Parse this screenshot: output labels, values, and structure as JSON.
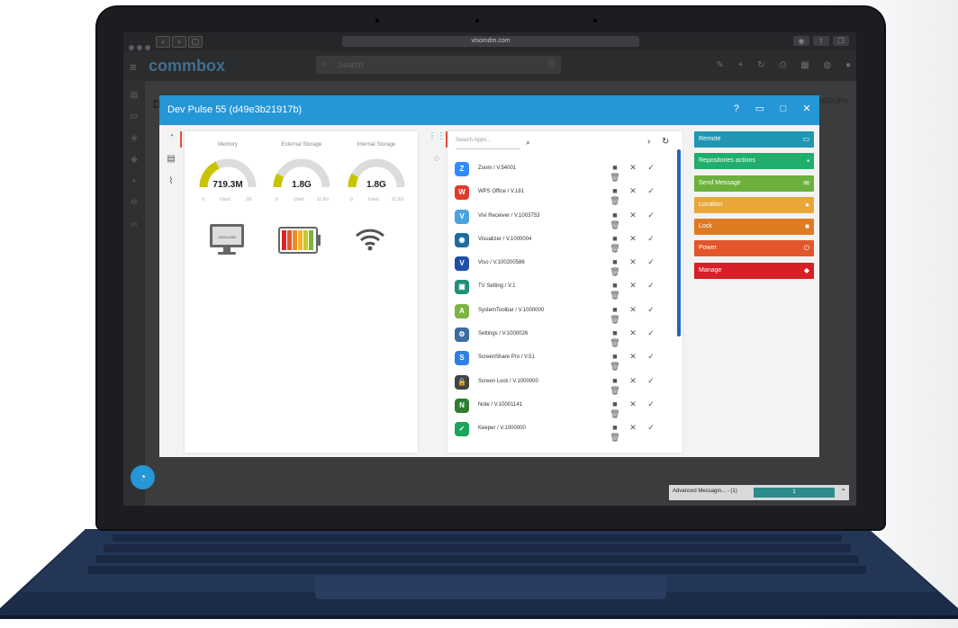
{
  "browser": {
    "url": "visomdm.com"
  },
  "app": {
    "logo": "commbox",
    "search_placeholder": "Search",
    "page_initial": "D",
    "groups_label": "GROUPS"
  },
  "modal": {
    "title": "Dev Pulse 55 (d49e3b21917b)",
    "gauges": [
      {
        "label": "Memory",
        "value": "719.3M",
        "min": "0",
        "max": "2G",
        "used": "Used",
        "fraction": 0.36
      },
      {
        "label": "External Storage",
        "value": "1.8G",
        "min": "0",
        "max": "11.6G",
        "used": "Used",
        "fraction": 0.16
      },
      {
        "label": "Internal Storage",
        "value": "1.8G",
        "min": "0",
        "max": "11.6G",
        "used": "Used",
        "fraction": 0.16
      }
    ],
    "display_resolution": "1920x1080",
    "search_apps_placeholder": "Search Apps...",
    "apps": [
      {
        "name": "Zoom / V.54001",
        "color": "#2d8cff",
        "glyph": "Z"
      },
      {
        "name": "WPS Office / V.181",
        "color": "#e03b2a",
        "glyph": "W"
      },
      {
        "name": "Vivi Receiver / V.1003753",
        "color": "#4aa3df",
        "glyph": "V"
      },
      {
        "name": "Visualizer / V.1000004",
        "color": "#1e6b9c",
        "glyph": "◉"
      },
      {
        "name": "Viso / V.100200586",
        "color": "#1f4fa8",
        "glyph": "V"
      },
      {
        "name": "TV Setting / V.1",
        "color": "#1e8f7a",
        "glyph": "▣"
      },
      {
        "name": "SystemToolbar / V.1000000",
        "color": "#7cb342",
        "glyph": "A"
      },
      {
        "name": "Settings / V.1000026",
        "color": "#3b6e9e",
        "glyph": "⚙"
      },
      {
        "name": "ScreenShare Pro / V.51",
        "color": "#2f7fe0",
        "glyph": "S"
      },
      {
        "name": "Screen Lock / V.1000000",
        "color": "#444444",
        "glyph": "🔒"
      },
      {
        "name": "Note / V.10001141",
        "color": "#2e7d32",
        "glyph": "N"
      },
      {
        "name": "Keeper / V.1000000",
        "color": "#1aa55a",
        "glyph": "✓"
      }
    ],
    "actions": [
      {
        "label": "Remote",
        "color": "#2196b3",
        "icon": "monitor-icon",
        "glyph": "▭"
      },
      {
        "label": "Repositories actions",
        "color": "#1fae6b",
        "icon": "save-icon",
        "glyph": "▪"
      },
      {
        "label": "Send Message",
        "color": "#6bb13c",
        "icon": "envelope-icon",
        "glyph": "✉"
      },
      {
        "label": "Location",
        "color": "#e9a63a",
        "icon": "pin-icon",
        "glyph": "●"
      },
      {
        "label": "Lock",
        "color": "#e07a22",
        "icon": "lock-icon",
        "glyph": "■"
      },
      {
        "label": "Power",
        "color": "#e2562c",
        "icon": "power-icon",
        "glyph": "⏻"
      },
      {
        "label": "Manage",
        "color": "#d61f26",
        "icon": "tag-icon",
        "glyph": "◆"
      }
    ]
  },
  "footer": {
    "advanced_messaging": "Advanced Messagin... - (1)",
    "count": "1"
  }
}
